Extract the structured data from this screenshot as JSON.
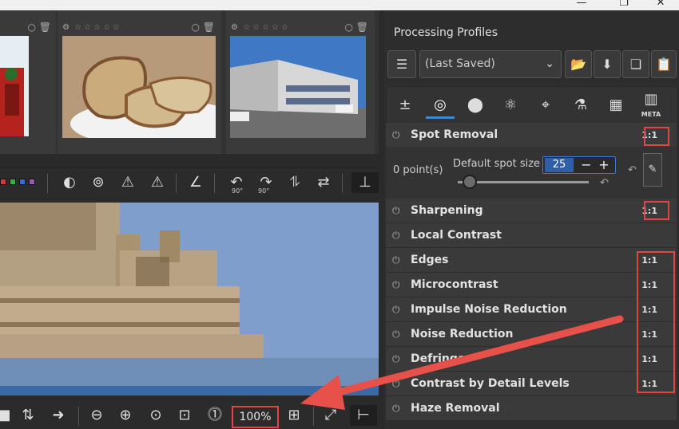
{
  "window": {
    "minimize": "—",
    "restore": "❐",
    "close": "✕"
  },
  "filmstrip": {
    "thumbnails": [
      {
        "rating": "☆☆☆☆☆",
        "scene": "red-object-outdoor"
      },
      {
        "rating": "☆☆☆☆☆",
        "scene": "bread-slices"
      },
      {
        "rating": "☆☆☆☆☆",
        "scene": "building-street"
      }
    ],
    "thumb_icons": {
      "gear": "⚙",
      "circle": "○",
      "trash": "🗑"
    }
  },
  "toolbar_top": {
    "color_labels": [
      "#d23a3a",
      "#31b043",
      "#3a6cd2",
      "#9b59b6"
    ],
    "buttons": [
      {
        "icon": "tone-curve-icon",
        "glyph": "◐"
      },
      {
        "icon": "triangle-circle-icon",
        "glyph": "⊚"
      },
      {
        "icon": "warning-shadow-icon",
        "glyph": "⚠"
      },
      {
        "icon": "warning-highlight-icon",
        "glyph": "⚠"
      },
      {
        "icon": "angle-icon",
        "glyph": "∠"
      },
      {
        "icon": "rotate-left-icon",
        "glyph": "↶",
        "sub": "90°"
      },
      {
        "icon": "rotate-right-icon",
        "glyph": "↷",
        "sub": "90°"
      },
      {
        "icon": "flip-vertical-icon",
        "glyph": "⥮"
      },
      {
        "icon": "flip-horizontal-icon",
        "glyph": "⇄"
      },
      {
        "icon": "export-icon",
        "glyph": "⊥"
      }
    ]
  },
  "toolbar_bottom": {
    "zoom_label": "100%",
    "buttons": [
      {
        "icon": "stop-icon",
        "glyph": "■"
      },
      {
        "icon": "sort-icon",
        "glyph": "⇅"
      },
      {
        "icon": "next-arrow-icon",
        "glyph": "➜"
      },
      {
        "icon": "zoom-out-icon",
        "glyph": "⊖"
      },
      {
        "icon": "zoom-in-icon",
        "glyph": "⊕"
      },
      {
        "icon": "zoom-fit-icon",
        "glyph": "⊙"
      },
      {
        "icon": "zoom-fit-crop-icon",
        "glyph": "⊡"
      },
      {
        "icon": "zoom-100-icon",
        "glyph": "⓵"
      },
      {
        "icon": "new-detail-window-icon",
        "glyph": "⊞"
      },
      {
        "icon": "fullscreen-icon",
        "glyph": "⤢"
      },
      {
        "icon": "toggle-panel-icon",
        "glyph": "⊢"
      }
    ]
  },
  "processing_profiles": {
    "title": "Processing Profiles",
    "selected": "(Last Saved)",
    "buttons": [
      {
        "icon": "profile-list-icon",
        "glyph": "☰"
      },
      {
        "icon": "open-folder-icon",
        "glyph": "📂"
      },
      {
        "icon": "save-icon",
        "glyph": "⬇"
      },
      {
        "icon": "copy-icon",
        "glyph": "❏"
      },
      {
        "icon": "paste-icon",
        "glyph": "📋"
      }
    ]
  },
  "tool_tabs": [
    {
      "icon": "exposure-tab-icon",
      "glyph": "±"
    },
    {
      "icon": "detail-tab-icon",
      "glyph": "◎",
      "active": true
    },
    {
      "icon": "color-tab-icon",
      "glyph": "⬤"
    },
    {
      "icon": "advanced-tab-icon",
      "glyph": "⚛"
    },
    {
      "icon": "transform-tab-icon",
      "glyph": "⌖"
    },
    {
      "icon": "raw-tab-icon",
      "glyph": "⚗"
    },
    {
      "icon": "checker-tab-icon",
      "glyph": "▦"
    },
    {
      "icon": "metadata-tab-icon",
      "glyph": "▥",
      "label": "META"
    }
  ],
  "tools": [
    {
      "name": "Spot Removal",
      "badge": "1:1"
    },
    {
      "name": "Sharpening",
      "badge": "1:1"
    },
    {
      "name": "Local Contrast",
      "badge": ""
    },
    {
      "name": "Edges",
      "badge": "1:1"
    },
    {
      "name": "Microcontrast",
      "badge": "1:1"
    },
    {
      "name": "Impulse Noise Reduction",
      "badge": "1:1"
    },
    {
      "name": "Noise Reduction",
      "badge": "1:1"
    },
    {
      "name": "Defringe",
      "badge": "1:1"
    },
    {
      "name": "Contrast by Detail Levels",
      "badge": "1:1"
    },
    {
      "name": "Haze Removal",
      "badge": ""
    }
  ],
  "spot_removal": {
    "point_count": "0 point(s)",
    "size_label": "Default spot size",
    "size_value": "25",
    "minus": "−",
    "plus": "+",
    "reset": "↶",
    "edit": "✎"
  },
  "annotation": {
    "box_color": "#e34545",
    "arrow_color": "#e8504a"
  }
}
